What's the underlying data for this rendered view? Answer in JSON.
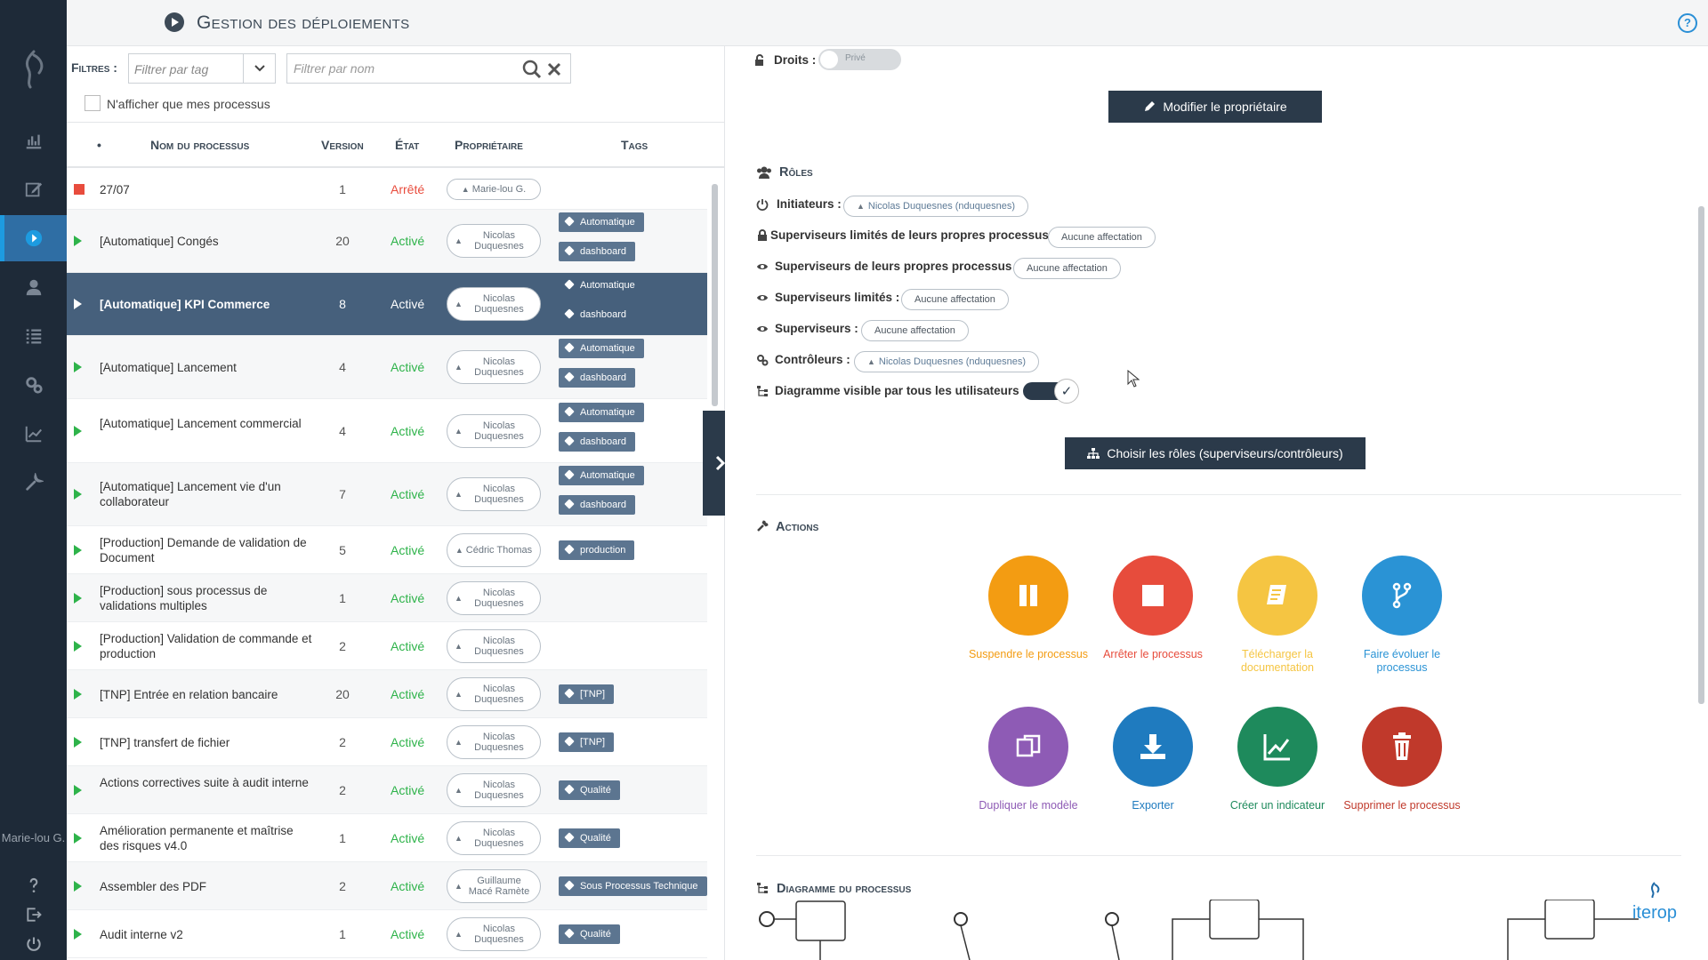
{
  "header": {
    "title": "Gestion des déploiements",
    "help": "?"
  },
  "sidebar": {
    "user": "Marie-lou G."
  },
  "filters": {
    "label": "Filtres :",
    "tag_placeholder": "Filtrer par tag",
    "name_placeholder": "Filtrer par nom",
    "only_mine": "N'afficher que mes processus"
  },
  "table": {
    "columns": [
      "•",
      "Nom du processus",
      "Version",
      "État",
      "Propriétaire",
      "Tags"
    ],
    "rows": [
      {
        "name": "27/07",
        "version": "1",
        "state": "Arrêté",
        "owner": "Marie-lou G.",
        "tags": []
      },
      {
        "name": "[Automatique] Congés",
        "version": "20",
        "state": "Activé",
        "owner": "Nicolas Duquesnes",
        "tags": [
          "Automatique",
          "dashboard"
        ]
      },
      {
        "name": "[Automatique] KPI Commerce",
        "version": "8",
        "state": "Activé",
        "owner": "Nicolas Duquesnes",
        "tags": [
          "Automatique",
          "dashboard"
        ]
      },
      {
        "name": "[Automatique] Lancement",
        "version": "4",
        "state": "Activé",
        "owner": "Nicolas Duquesnes",
        "tags": [
          "Automatique",
          "dashboard"
        ]
      },
      {
        "name": "[Automatique] Lancement commercial",
        "version": "4",
        "state": "Activé",
        "owner": "Nicolas Duquesnes",
        "tags": [
          "Automatique",
          "dashboard"
        ]
      },
      {
        "name": "[Automatique] Lancement vie d'un collaborateur",
        "version": "7",
        "state": "Activé",
        "owner": "Nicolas Duquesnes",
        "tags": [
          "Automatique",
          "dashboard"
        ]
      },
      {
        "name": "[Production] Demande de validation de Document",
        "version": "5",
        "state": "Activé",
        "owner": "Cédric Thomas",
        "tags": [
          "production"
        ]
      },
      {
        "name": "[Production] sous processus de validations multiples",
        "version": "1",
        "state": "Activé",
        "owner": "Nicolas Duquesnes",
        "tags": []
      },
      {
        "name": "[Production] Validation de commande et production",
        "version": "2",
        "state": "Activé",
        "owner": "Nicolas Duquesnes",
        "tags": []
      },
      {
        "name": "[TNP] Entrée en relation bancaire",
        "version": "20",
        "state": "Activé",
        "owner": "Nicolas Duquesnes",
        "tags": [
          "[TNP]"
        ]
      },
      {
        "name": "[TNP] transfert de fichier",
        "version": "2",
        "state": "Activé",
        "owner": "Nicolas Duquesnes",
        "tags": [
          "[TNP]"
        ]
      },
      {
        "name": "Actions correctives suite à audit interne",
        "version": "2",
        "state": "Activé",
        "owner": "Nicolas Duquesnes",
        "tags": [
          "Qualité"
        ]
      },
      {
        "name": "Amélioration permanente et maîtrise des risques v4.0",
        "version": "1",
        "state": "Activé",
        "owner": "Nicolas Duquesnes",
        "tags": [
          "Qualité"
        ]
      },
      {
        "name": "Assembler des PDF",
        "version": "2",
        "state": "Activé",
        "owner": "Guillaume Macé Ramète",
        "tags": [
          "Sous Processus Technique"
        ]
      },
      {
        "name": "Audit interne v2",
        "version": "1",
        "state": "Activé",
        "owner": "Nicolas Duquesnes",
        "tags": [
          "Qualité"
        ]
      }
    ]
  },
  "details": {
    "droits_label": "Droits :",
    "droits_value": "Privé",
    "modify_owner": "Modifier le propriétaire",
    "roles_title": "Rôles",
    "roles": [
      {
        "label": "Initiateurs :",
        "value": "Nicolas Duquesnes (nduquesnes)"
      },
      {
        "label": "Superviseurs limités de leurs propres processus :",
        "value": "Aucune affectation"
      },
      {
        "label": "Superviseurs de leurs propres processus :",
        "value": "Aucune affectation"
      },
      {
        "label": "Superviseurs limités :",
        "value": "Aucune affectation"
      },
      {
        "label": "Superviseurs :",
        "value": "Aucune affectation"
      },
      {
        "label": "Contrôleurs :",
        "value": "Nicolas Duquesnes (nduquesnes)"
      }
    ],
    "diagram_visible_label": "Diagramme visible par tous les utilisateurs :",
    "choose_roles": "Choisir les rôles (superviseurs/contrôleurs)",
    "actions_title": "Actions",
    "actions": [
      {
        "label": "Suspendre le processus",
        "color": "#f39c12",
        "icon": "pause-icon"
      },
      {
        "label": "Arrêter le processus",
        "color": "#e74c3c",
        "icon": "stop-icon"
      },
      {
        "label": "Télécharger la documentation",
        "color": "#f5c542",
        "icon": "book-icon"
      },
      {
        "label": "Faire évoluer le processus",
        "color": "#2a93d5",
        "icon": "branch-icon"
      },
      {
        "label": "Dupliquer le modèle",
        "color": "#8e5bb5",
        "icon": "copy-icon"
      },
      {
        "label": "Exporter",
        "color": "#1f7bbf",
        "icon": "download-icon"
      },
      {
        "label": "Créer un indicateur",
        "color": "#1e8a5c",
        "icon": "chart-icon"
      },
      {
        "label": "Supprimer le processus",
        "color": "#c0392b",
        "icon": "trash-icon"
      }
    ],
    "diagram_title": "Diagramme du processus",
    "brand": "iterop"
  }
}
